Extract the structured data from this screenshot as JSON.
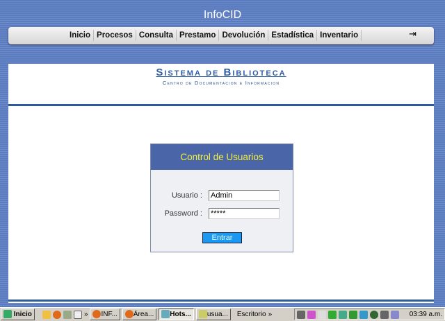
{
  "app_title": "InfoCID",
  "menu": [
    "Inicio",
    "Procesos",
    "Consulta",
    "Prestamo",
    "Devolución",
    "Estadística",
    "Inventario"
  ],
  "logo": {
    "title": "Sistema de Biblioteca",
    "subtitle": "Centro de Documentacion e Informacion"
  },
  "login": {
    "title": "Control de Usuarios",
    "user_label": "Usuario :",
    "user_value": "Admin",
    "password_label": "Password :",
    "password_value": "*****",
    "submit": "Entrar"
  },
  "taskbar": {
    "start": "Inicio",
    "more": "»",
    "tasks": [
      "INF...",
      "Área...",
      "Hots...",
      "usua..."
    ],
    "desktop": "Escritorio",
    "clock": "03:39 a.m."
  }
}
